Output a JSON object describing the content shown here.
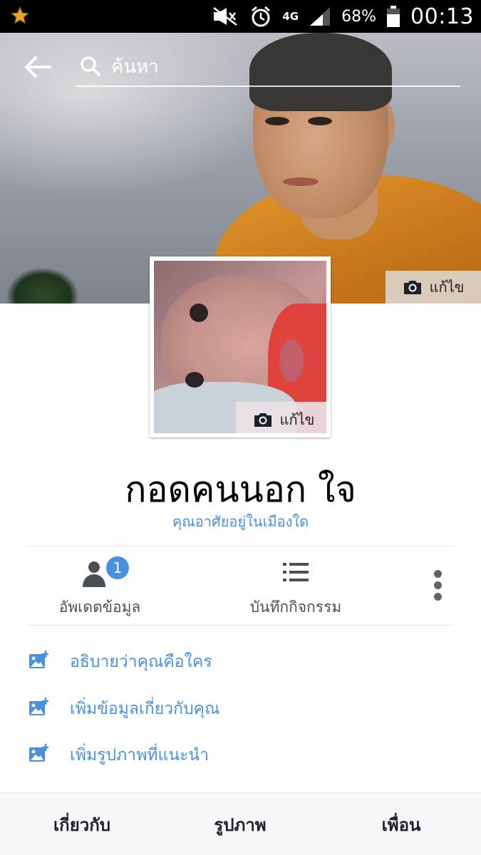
{
  "status_bar": {
    "network": "4G",
    "battery": "68%",
    "time": "00:13"
  },
  "search": {
    "placeholder": "ค้นหา"
  },
  "cover": {
    "edit_label": "แก้ไข"
  },
  "profile_picture": {
    "edit_label": "แก้ไข"
  },
  "profile": {
    "name": "กอดคนนอก ใจ",
    "location_prompt": "คุณอาศัยอยู่ในเมืองใด"
  },
  "actions": {
    "update_info": {
      "label": "อัพเดตข้อมูล",
      "badge_count": "1"
    },
    "activity_log": {
      "label": "บันทึกกิจกรรม"
    }
  },
  "intro_items": [
    {
      "label": "อธิบายว่าคุณคือใคร",
      "icon": "add-photo-icon"
    },
    {
      "label": "เพิ่มข้อมูลเกี่ยวกับคุณ",
      "icon": "add-photo-icon"
    },
    {
      "label": "เพิ่มรูปภาพที่แนะนำ",
      "icon": "add-photo-icon"
    }
  ],
  "tabs": {
    "about": "เกี่ยวกับ",
    "photos": "รูปภาพ",
    "friends": "เพื่อน"
  },
  "colors": {
    "accent_blue": "#4a90e2",
    "text_dark": "#1d2129",
    "text_gray": "#4b4f56",
    "tab_bar_bg": "#f6f7f9"
  }
}
